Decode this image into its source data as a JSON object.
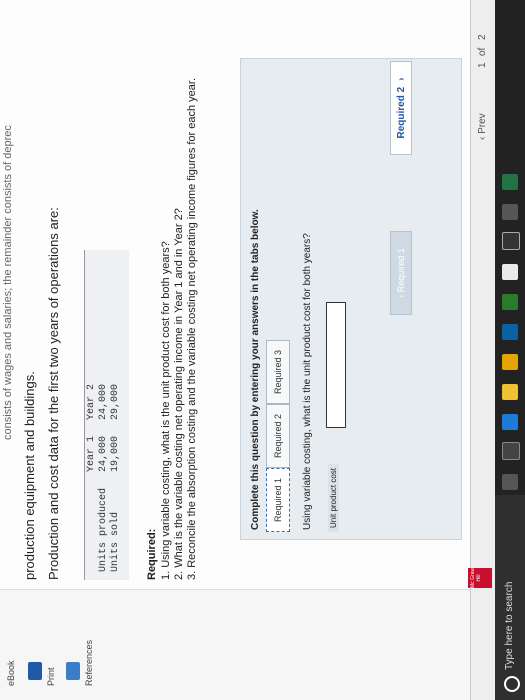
{
  "header": {
    "cut_text": "consists of wages and salaries; the remainder consists of deprec"
  },
  "rail": {
    "ebook_label": "eBook",
    "print_label": "Print",
    "references_label": "References"
  },
  "content": {
    "intro_line": "production equipment and buildings.",
    "data_line": "Production and cost data for the first two years of operations are:",
    "table": {
      "headers": [
        "",
        "Year 1",
        "Year 2"
      ],
      "rows": [
        [
          "Units produced",
          "24,000",
          "24,000"
        ],
        [
          "Units sold",
          "19,000",
          "29,000"
        ]
      ]
    },
    "required_heading": "Required:",
    "required_items": [
      "1. Using variable costing, what is the unit product cost for both years?",
      "2. What is the variable costing net operating income in Year 1 and in Year 2?",
      "3. Reconcile the absorption costing and the variable costing net operating income figures for each year."
    ],
    "instruction": "Complete this question by entering your answers in the tabs below.",
    "tabs": [
      "Required 1",
      "Required 2",
      "Required 3"
    ],
    "question": "Using variable costing, what is the unit product cost for both years?",
    "input_label": "Unit product cost",
    "input_value": "",
    "prev_req_label": "‹  Required 1",
    "next_req_label": "Required 2",
    "next_req_chevron": "›"
  },
  "footer": {
    "prev_label": "‹  Prev",
    "page_current": "1",
    "page_of": "of",
    "page_total": "2"
  },
  "taskbar": {
    "search_placeholder": "Type here to search",
    "logo_text": "Mc Graw Hill"
  },
  "colors": {
    "accent": "#1e5aa8",
    "panel": "#e7ecf0",
    "logo": "#c8102e"
  }
}
